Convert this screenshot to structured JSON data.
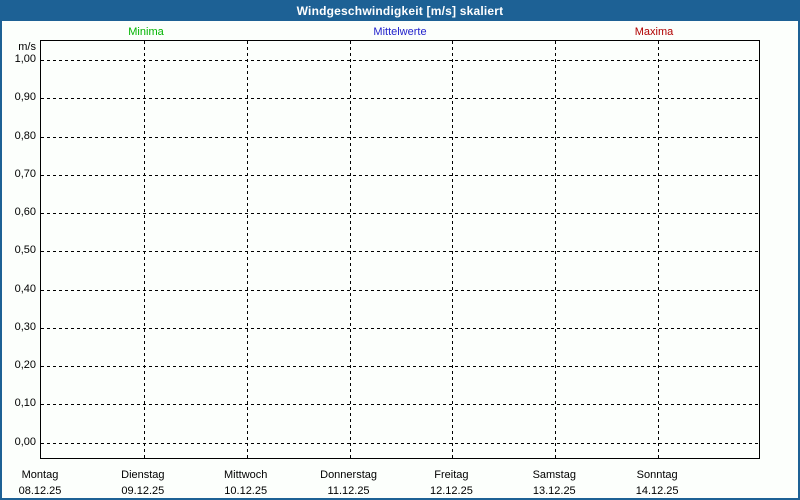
{
  "window": {
    "title": "Windgeschwindigkeit [m/s] skaliert"
  },
  "colors": {
    "titlebar_bg": "#1d6195",
    "frame_border": "#1d6195",
    "background": "#fcfffc",
    "grid": "#000000",
    "minima": "#00b400",
    "mittelwerte": "#2222cc",
    "maxima": "#b00000"
  },
  "legend": {
    "items": [
      {
        "label": "Minima",
        "color": "#00b400"
      },
      {
        "label": "Mittelwerte",
        "color": "#2222cc"
      },
      {
        "label": "Maxima",
        "color": "#b00000"
      }
    ]
  },
  "y_axis": {
    "unit": "m/s",
    "ticks": [
      "1,00",
      "0,90",
      "0,80",
      "0,70",
      "0,60",
      "0,50",
      "0,40",
      "0,30",
      "0,20",
      "0,10",
      "0,00"
    ]
  },
  "x_axis": {
    "days": [
      {
        "name": "Montag",
        "date": "08.12.25"
      },
      {
        "name": "Dienstag",
        "date": "09.12.25"
      },
      {
        "name": "Mittwoch",
        "date": "10.12.25"
      },
      {
        "name": "Donnerstag",
        "date": "11.12.25"
      },
      {
        "name": "Freitag",
        "date": "12.12.25"
      },
      {
        "name": "Samstag",
        "date": "13.12.25"
      },
      {
        "name": "Sonntag",
        "date": "14.12.25"
      }
    ]
  },
  "chart_data": {
    "type": "line",
    "title": "Windgeschwindigkeit [m/s] skaliert",
    "xlabel": "",
    "ylabel": "m/s",
    "ylim": [
      0.0,
      1.0
    ],
    "y_tick_interval": 0.1,
    "y_tick_labels": [
      "0,00",
      "0,10",
      "0,20",
      "0,30",
      "0,40",
      "0,50",
      "0,60",
      "0,70",
      "0,80",
      "0,90",
      "1,00"
    ],
    "categories": [
      "Montag 08.12.25",
      "Dienstag 09.12.25",
      "Mittwoch 10.12.25",
      "Donnerstag 11.12.25",
      "Freitag 12.12.25",
      "Samstag 13.12.25",
      "Sonntag 14.12.25"
    ],
    "grid": true,
    "legend_position": "top",
    "series": [
      {
        "name": "Minima",
        "color": "#00b400",
        "values": []
      },
      {
        "name": "Mittelwerte",
        "color": "#2222cc",
        "values": []
      },
      {
        "name": "Maxima",
        "color": "#b00000",
        "values": []
      }
    ],
    "no_data_plotted": true
  }
}
